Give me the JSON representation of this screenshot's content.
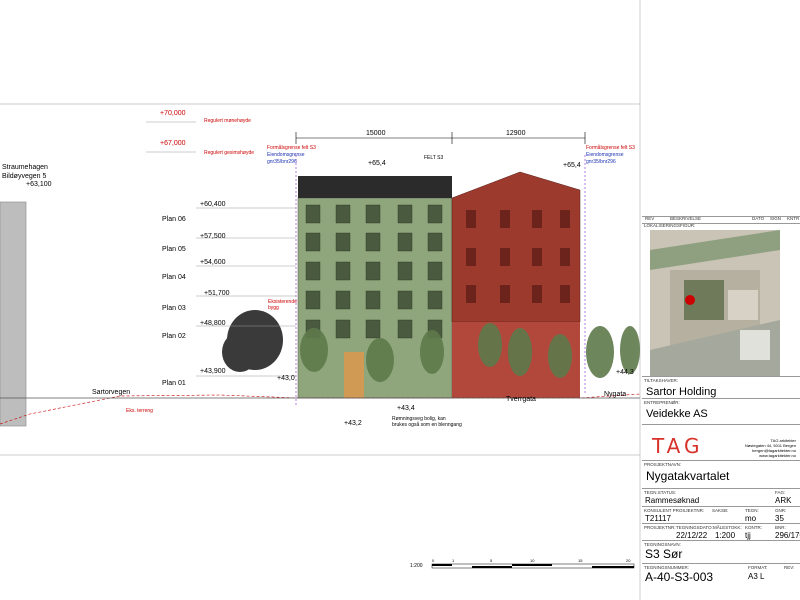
{
  "drawing": {
    "elevations_red": [
      {
        "value": "+70,000",
        "note": "Regulert mønehøyde"
      },
      {
        "value": "+67,000",
        "note": "Regulert gesimshøyde"
      }
    ],
    "neighbor": {
      "name": "Straumehagen\nBildøyvegen 5",
      "line1": "Straumehagen",
      "line2": "Bildøyvegen 5",
      "elev": "+63,100"
    },
    "plans": [
      {
        "label": "Plan 06",
        "elev": "+60,400"
      },
      {
        "label": "Plan 05",
        "elev": "+57,500"
      },
      {
        "label": "Plan 04",
        "elev": "+54,600"
      },
      {
        "label": "Plan 03",
        "elev": "+51,700"
      },
      {
        "label": "Plan 02",
        "elev": "+48,800"
      },
      {
        "label": "Plan 01",
        "elev": "+43,900"
      }
    ],
    "dims": {
      "left": "15000",
      "right": "12900"
    },
    "felt": "FELT S3",
    "formal_left": {
      "l1": "Formålsgrense felt S3",
      "l2": "Eiendomsgrense",
      "l3": "gnr35/bnr296"
    },
    "formal_right": {
      "l1": "Formålsgrense felt S3",
      "l2": "Eiendomsgrense",
      "l3": "gnr35/bnr296"
    },
    "roof_left": "+65,4",
    "roof_right": "+65,4",
    "existing_tree": {
      "l1": "Eksisterende",
      "l2": "bygg"
    },
    "street_left": "Sartorvegen",
    "street_mid": "Tverrgata",
    "street_right": "Nygata",
    "terrain": "Eks. terreng",
    "el_43_0": "+43,0",
    "el_43_4": "+43,4",
    "el_43_2": "+43,2",
    "el_44_3": "+44,3",
    "escape_note_1": "Rømningsveg bolig, kan",
    "escape_note_2": "brukes også som en blenngang",
    "scale_label": "1:200",
    "scale_ticks": [
      "0",
      "1",
      "5",
      "10",
      "15",
      "20"
    ]
  },
  "titleblock": {
    "rev_header": [
      "REV",
      "BESKRIVELSE",
      "DATO",
      "SIGN",
      "KNTR"
    ],
    "lokalisering_label": "LOKALISERINGSFIGUR:",
    "tiltakshaver_label": "TILTAKSHAVER:",
    "tiltakshaver": "Sartor Holding",
    "entreprenor_label": "ENTREPRENØR:",
    "entreprenor": "Veidekke AS",
    "logo_text": "TAG",
    "firm": {
      "l1": "TAG arkitekter",
      "l2": "Nøstegaten 44, 5011 Bergen",
      "l3": "bergen@tagarkitekter.no",
      "l4": "www.tagarkitekter.no"
    },
    "prosjektnavn_label": "PROSJEKTNAVN:",
    "prosjektnavn": "Nygatakvartalet",
    "tegnstatus_label": "TEGN.STATUS:",
    "tegnstatus": "Rammesøknad",
    "fag_label": "FAG:",
    "fag": "ARK",
    "konsulent_label": "KONSULENT PROSJEKTNR:",
    "konsulent": "T21117",
    "saksb_label": "SAKSB:",
    "saksb": "",
    "tegn_label": "TEGN:",
    "tegn": "mo",
    "gnr_label": "GNR:",
    "gnr": "35",
    "prosjektnr_label": "PROSJEKTNR:",
    "prosjektnr": "",
    "tegningsdato_label": "TEGNINGSDATO:",
    "tegningsdato": "22/12/22",
    "malestokk_label": "MÅLESTOKK:",
    "malestokk": "1:200",
    "kontr_label": "KONTR:",
    "kontr": "tjj",
    "bnr_label": "BNR:",
    "bnr": "296/170",
    "tegningsnavn_label": "TEGNINGSNAVN:",
    "tegningsnavn": "S3 Sør",
    "tegningsnummer_label": "TEGNINGSNUMMER:",
    "tegningsnummer": "A-40-S3-003",
    "format_label": "FORMAT:",
    "format": "A3 L",
    "rev_label": "REV:",
    "rev": ""
  }
}
